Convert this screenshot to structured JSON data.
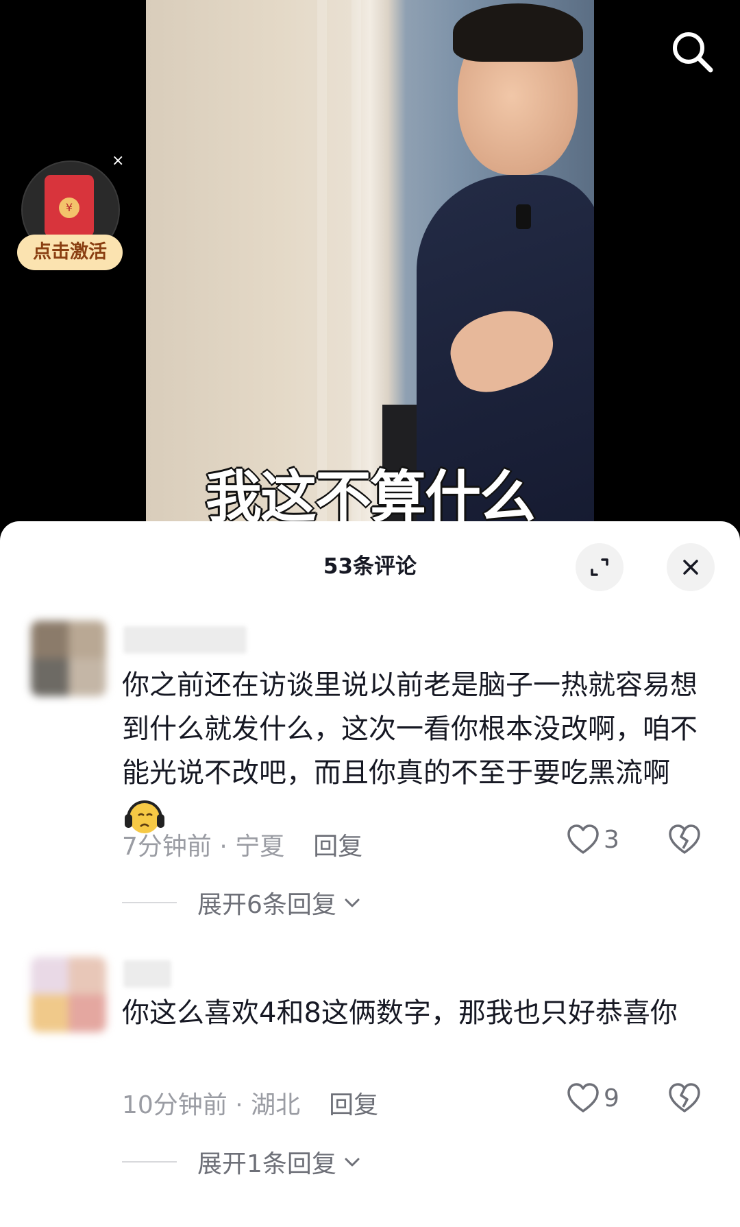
{
  "video": {
    "subtitle": "我这不算什么",
    "red_packet_label": "点击激活",
    "red_packet_close": "×",
    "red_packet_seal": "¥"
  },
  "panel": {
    "title": "53条评论",
    "close_symbol": "✕"
  },
  "comments": [
    {
      "text": "你之前还在访谈里说以前老是脑子一热就容易想到什么就发什么，这次一看你根本没改啊，咱不能光说不改吧，而且你真的不至于要吃黑流啊",
      "emoji": "crying-face-with-headphones",
      "time": "7分钟前",
      "separator": " · ",
      "location": "宁夏",
      "reply_label": "回复",
      "likes": "3",
      "expand_label": "展开6条回复"
    },
    {
      "text": "你这么喜欢4和8这俩数字，那我也只好恭喜你",
      "time": "10分钟前",
      "separator": " · ",
      "location": "湖北",
      "reply_label": "回复",
      "likes": "9",
      "expand_label": "展开1条回复"
    }
  ],
  "icons": {
    "search": "search-icon",
    "fullscreen": "fullscreen-icon",
    "close": "close-icon",
    "heart": "heart-icon",
    "broken_heart": "broken-heart-icon",
    "chevron": "chevron-down-icon"
  },
  "colors": {
    "panel_bg": "#ffffff",
    "text_primary": "#161823",
    "text_secondary": "#9a9ca3",
    "red_packet": "#d8343c",
    "red_packet_label_bg": "#fbe3b0"
  }
}
